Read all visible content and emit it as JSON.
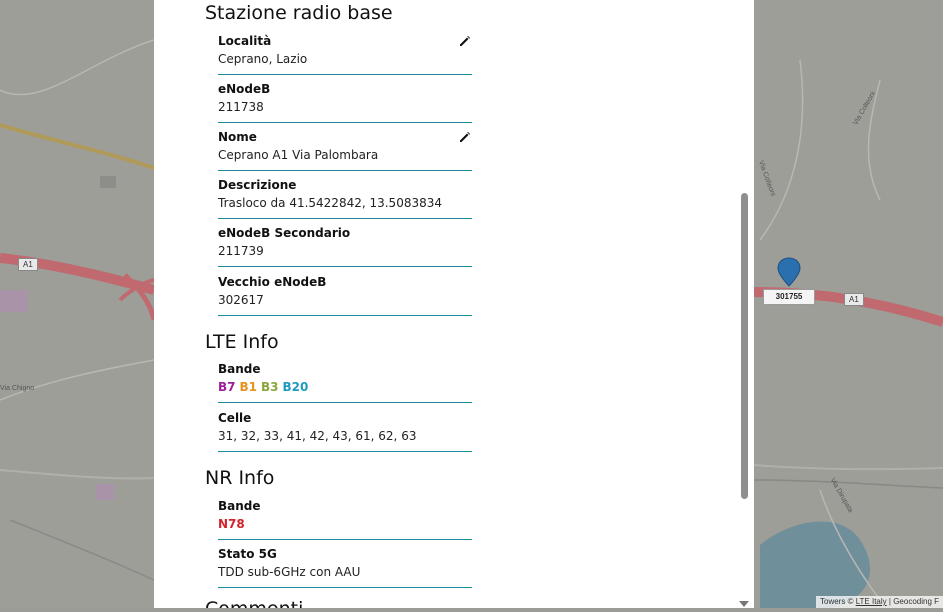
{
  "map": {
    "road_shields": [
      "A1",
      "A1"
    ],
    "street_labels": [
      "Via Colleoni",
      "Via Colleoni",
      "Via Chigno",
      "Via Dirupata"
    ],
    "marker_label": "301755",
    "attribution": {
      "prefix": "Towers © ",
      "brand": "LTE Italy",
      "suffix": " | Geocoding F"
    }
  },
  "panel": {
    "sections": {
      "station": {
        "title": "Stazione radio base"
      },
      "lte": {
        "title": "LTE Info"
      },
      "nr": {
        "title": "NR Info"
      },
      "cut": {
        "title": "Commenti"
      }
    },
    "fields": {
      "localita": {
        "label": "Località",
        "value": "Ceprano, Lazio"
      },
      "enodeb": {
        "label": "eNodeB",
        "value": "211738"
      },
      "nome": {
        "label": "Nome",
        "value": "Ceprano A1 Via Palombara"
      },
      "descrizione": {
        "label": "Descrizione",
        "value": "Trasloco da 41.5422842, 13.5083834"
      },
      "enodeb_secondario": {
        "label": "eNodeB Secondario",
        "value": "211739"
      },
      "vecchio_enodeb": {
        "label": "Vecchio eNodeB",
        "value": "302617"
      },
      "lte_bande": {
        "label": "Bande",
        "bands": [
          {
            "name": "B7",
            "color": "#9b1f9b"
          },
          {
            "name": "B1",
            "color": "#e8931e"
          },
          {
            "name": "B3",
            "color": "#8aa63a"
          },
          {
            "name": "B20",
            "color": "#1e9bbf"
          }
        ]
      },
      "celle": {
        "label": "Celle",
        "value": "31, 32, 33, 41, 42, 43, 61, 62, 63"
      },
      "nr_bande": {
        "label": "Bande",
        "bands": [
          {
            "name": "N78",
            "color": "#d4232b"
          }
        ]
      },
      "stato_5g": {
        "label": "Stato 5G",
        "value": "TDD sub-6GHz con AAU"
      }
    }
  },
  "colors": {
    "field_underline": "#1f8a9a",
    "scrollbar_thumb": "#8f8f8f"
  }
}
